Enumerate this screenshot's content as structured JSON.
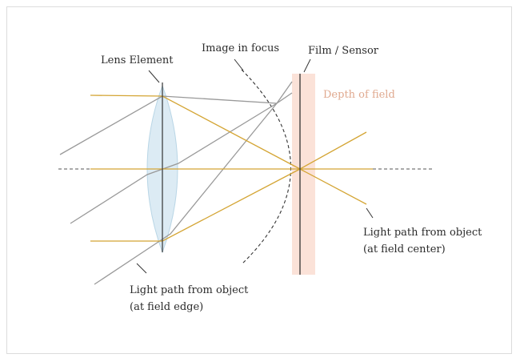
{
  "labels": {
    "lens_element": "Lens Element",
    "image_in_focus": "Image in focus",
    "film_sensor": "Film / Sensor",
    "depth_of_field": "Depth of field",
    "center_path_line1": "Light path from object",
    "center_path_line2": "(at field center)",
    "edge_path_line1": "Light path from object",
    "edge_path_line2": "(at field edge)"
  },
  "colors": {
    "center_rays": "#d4a534",
    "edge_rays": "#999999",
    "lens_fill": "#dcebf4",
    "lens_stroke": "#b9d6e6",
    "dof_fill": "#fbe2d8",
    "dof_text": "#e0a98f",
    "axis": "#555555",
    "sensor": "#333333"
  }
}
